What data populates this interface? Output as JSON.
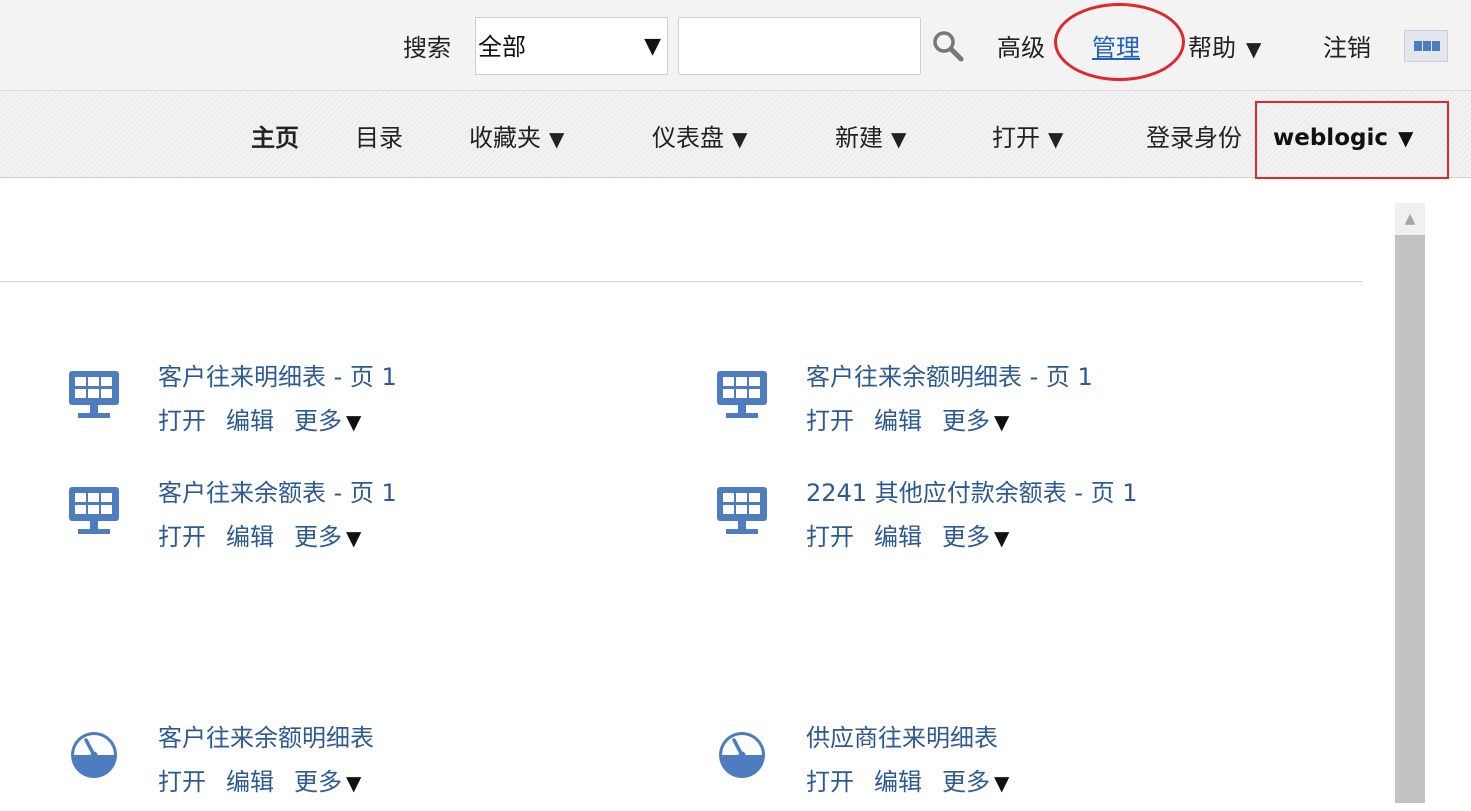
{
  "topbar": {
    "search_label": "搜索",
    "scope_value": "全部",
    "search_placeholder": "",
    "advanced": "高级",
    "admin": "管理",
    "help": "帮助",
    "signout": "注销"
  },
  "nav": {
    "home": "主页",
    "catalog": "目录",
    "favorites": "收藏夹",
    "dashboards": "仪表盘",
    "new": "新建",
    "open": "打开",
    "signed_in_as": "登录身份",
    "username": "weblogic"
  },
  "items": [
    {
      "title": "客户往来明细表 - 页 1",
      "type": "dashboard-icon",
      "open": "打开",
      "edit": "编辑",
      "more": "更多"
    },
    {
      "title": "客户往来余额明细表 - 页 1",
      "type": "dashboard-icon",
      "open": "打开",
      "edit": "编辑",
      "more": "更多"
    },
    {
      "title": "客户往来余额表 - 页 1",
      "type": "dashboard-icon",
      "open": "打开",
      "edit": "编辑",
      "more": "更多"
    },
    {
      "title": "2241 其他应付款余额表 - 页 1",
      "type": "dashboard-icon",
      "open": "打开",
      "edit": "编辑",
      "more": "更多"
    },
    {
      "title": "客户往来余额明细表",
      "type": "gauge-icon",
      "open": "打开",
      "edit": "编辑",
      "more": "更多"
    },
    {
      "title": "供应商往来明细表",
      "type": "gauge-icon",
      "open": "打开",
      "edit": "编辑",
      "more": "更多"
    }
  ],
  "colors": {
    "link": "#2d5a93",
    "icon": "#4d7dbf",
    "annotation": "#e0282c"
  }
}
